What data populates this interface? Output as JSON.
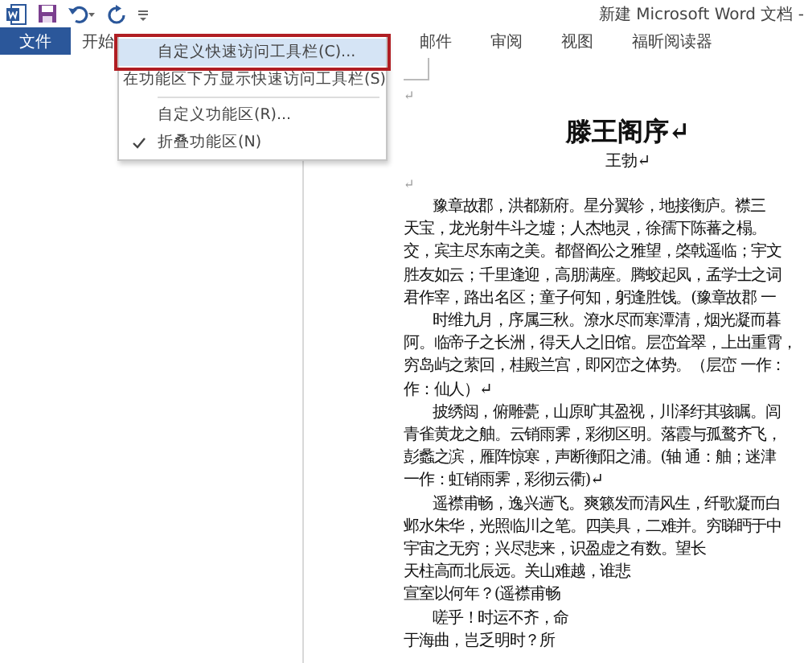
{
  "window": {
    "title": "新建 Microsoft Word 文档 -"
  },
  "tabs": [
    {
      "label": "文件",
      "selected": true
    },
    {
      "label": "开始",
      "selected": false
    },
    {
      "label": "邮件",
      "selected": false
    },
    {
      "label": "审阅",
      "selected": false
    },
    {
      "label": "视图",
      "selected": false
    },
    {
      "label": "福昕阅读器",
      "selected": false
    }
  ],
  "menu": {
    "items": [
      {
        "kind": "item",
        "label": "自定义快速访问工具栏(C)...",
        "selected": true,
        "checked": false
      },
      {
        "kind": "item",
        "label": "在功能区下方显示快速访问工具栏(S)",
        "selected": false,
        "checked": false
      },
      {
        "kind": "separator"
      },
      {
        "kind": "item",
        "label": "自定义功能区(R)...",
        "selected": false,
        "checked": false
      },
      {
        "kind": "item",
        "label": "折叠功能区(N)",
        "selected": false,
        "checked": true
      }
    ]
  },
  "document": {
    "paragraphs": [
      {
        "kind": "blank",
        "lines": [
          "↵"
        ]
      },
      {
        "kind": "title",
        "lines": [
          "滕王阁序↵"
        ]
      },
      {
        "kind": "author",
        "lines": [
          "王勃↵"
        ]
      },
      {
        "kind": "blank",
        "lines": [
          "↵"
        ]
      },
      {
        "kind": "body",
        "lines": [
          "豫章故郡，洪都新府。星分翼轸，地接衡庐。襟三",
          "天宝，龙光射牛斗之墟；人杰地灵，徐孺下陈蕃之榻。",
          "交，宾主尽东南之美。都督阎公之雅望，棨戟遥临；宇文",
          "胜友如云；千里逢迎，高朋满座。腾蛟起凤，孟学士之词",
          "君作宰，路出名区；童子何知，躬逢胜饯。(豫章故郡 一"
        ]
      },
      {
        "kind": "body",
        "lines": [
          "时维九月，序属三秋。潦水尽而寒潭清，烟光凝而暮",
          "阿。临帝子之长洲，得天人之旧馆。层峦耸翠，上出重霄，",
          "穷岛屿之萦回，桂殿兰宫，即冈峦之体势。（层峦 一作：",
          "作：仙人）↵"
        ]
      },
      {
        "kind": "body",
        "lines": [
          "披绣闼，俯雕甍，山原旷其盈视，川泽纡其骇瞩。闾",
          "青雀黄龙之舳。云销雨霁，彩彻区明。落霞与孤鹜齐飞，",
          "彭蠡之滨，雁阵惊寒，声断衡阳之浦。(轴 通：舳；迷津",
          "一作：虹销雨霁，彩彻云衢)↵"
        ]
      },
      {
        "kind": "body",
        "lines": [
          "遥襟甫畅，逸兴遄飞。爽籁发而清风生，纤歌凝而白",
          "邺水朱华，光照临川之笔。四美具，二难并。穷睇眄于中",
          "宇宙之无穷；兴尽悲来，识盈虚之有数。望长",
          "天柱高而北辰远。关山难越，谁悲",
          "宣室以何年？(遥襟甫畅"
        ]
      },
      {
        "kind": "body",
        "lines": [
          "嗟乎！时运不齐，命",
          "于海曲，岂乏明时？所"
        ]
      }
    ]
  }
}
